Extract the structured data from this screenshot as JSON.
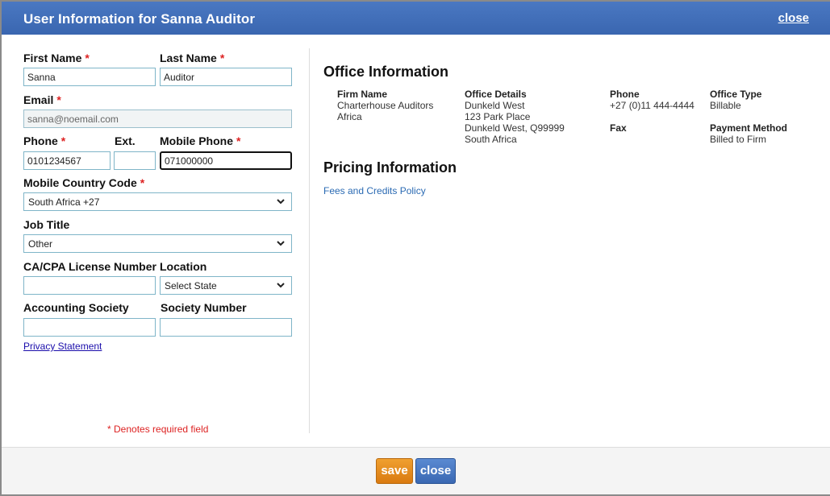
{
  "dialog": {
    "title": "User Information for Sanna Auditor",
    "close_link": "close"
  },
  "form": {
    "first_name": {
      "label": "First Name",
      "required": "*",
      "value": "Sanna"
    },
    "last_name": {
      "label": "Last Name",
      "required": "*",
      "value": "Auditor"
    },
    "email": {
      "label": "Email",
      "required": "*",
      "value": "sanna@noemail.com"
    },
    "phone": {
      "label": "Phone",
      "required": "*",
      "value": "0101234567"
    },
    "ext": {
      "label": "Ext.",
      "value": ""
    },
    "mobile_phone": {
      "label": "Mobile Phone",
      "required": "*",
      "value": "071000000"
    },
    "mobile_country_code": {
      "label": "Mobile Country Code",
      "required": "*",
      "value": "South Africa +27"
    },
    "job_title": {
      "label": "Job Title",
      "value": "Other"
    },
    "license_number": {
      "label": "CA/CPA License Number",
      "value": ""
    },
    "location": {
      "label": "Location",
      "value": "Select State"
    },
    "accounting_society": {
      "label": "Accounting Society",
      "value": ""
    },
    "society_number": {
      "label": "Society Number",
      "value": ""
    },
    "privacy_link": "Privacy Statement",
    "required_note": "* Denotes required field"
  },
  "office": {
    "heading": "Office Information",
    "firm_name_label": "Firm Name",
    "firm_name_lines": [
      "Charterhouse Auditors",
      "Africa"
    ],
    "office_details_label": "Office Details",
    "office_details_lines": [
      "Dunkeld West",
      "123 Park Place",
      "Dunkeld West, Q99999",
      "South Africa"
    ],
    "phone_label": "Phone",
    "phone_value": "+27 (0)11 444-4444",
    "fax_label": "Fax",
    "office_type_label": "Office Type",
    "office_type_value": "Billable",
    "payment_method_label": "Payment Method",
    "payment_method_value": "Billed to Firm"
  },
  "pricing": {
    "heading": "Pricing Information",
    "fees_link": "Fees and Credits Policy"
  },
  "footer": {
    "save_label": "save",
    "close_label": "close"
  }
}
